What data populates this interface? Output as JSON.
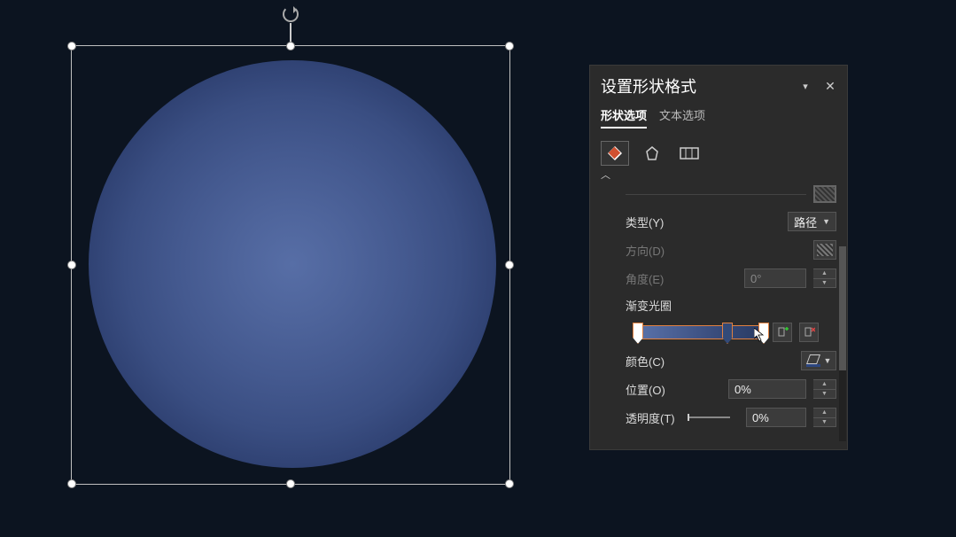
{
  "canvas": {
    "shape_fill_gradient": {
      "inner": "#576ea6",
      "outer": "#1d2c52"
    }
  },
  "format_pane": {
    "title": "设置形状格式",
    "tabs": {
      "shape_options": "形状选项",
      "text_options": "文本选项"
    },
    "categories": {
      "fill_line": "fill-line-icon",
      "effects": "effects-icon",
      "size_props": "size-properties-icon"
    },
    "props": {
      "type_label": "类型(Y)",
      "type_value": "路径",
      "direction_label": "方向(D)",
      "angle_label": "角度(E)",
      "angle_value": "0°",
      "gradient_stops_label": "渐变光圈",
      "color_label": "颜色(C)",
      "position_label": "位置(O)",
      "position_value": "0%",
      "transparency_label": "透明度(T)",
      "transparency_value": "0%"
    },
    "gradient_stops": [
      {
        "position": 0,
        "color": "#5a72aa"
      },
      {
        "position": 70,
        "color": "#334a78"
      },
      {
        "position": 100,
        "color": "#283a62"
      }
    ]
  }
}
